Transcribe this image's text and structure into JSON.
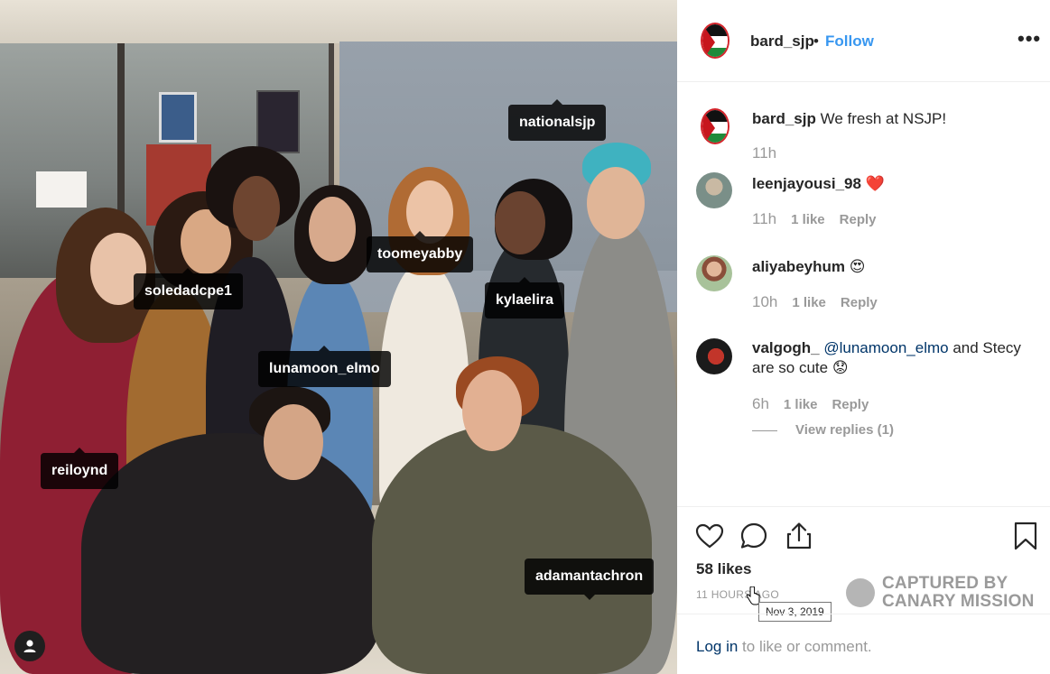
{
  "photo": {
    "tags": [
      "nationalsjp",
      "toomeyabby",
      "soledadcpe1",
      "kylaelira",
      "lunamoon_elmo",
      "reiloynd",
      "adamantachron"
    ],
    "colors": {
      "tag_bg": "#000000",
      "map_warm": "#f39b1d",
      "map_cool": "#35a7ff"
    }
  },
  "header": {
    "username": "bard_sjp",
    "separator": "•",
    "follow_label": "Follow",
    "more_icon": "more-horizontal-icon"
  },
  "comments": [
    {
      "user": "bard_sjp",
      "text": " We fresh at NSJP!",
      "time": "11h"
    },
    {
      "user": "leenjayousi_98",
      "text": "❤️",
      "time": "11h",
      "likes": "1 like",
      "reply": "Reply"
    },
    {
      "user": "aliyabeyhum",
      "text": "😍",
      "time": "10h",
      "likes": "1 like",
      "reply": "Reply"
    },
    {
      "user": "valgogh_",
      "mention": "@lunamoon_elmo",
      "text": " and Stecy are so cute 😟",
      "time": "6h",
      "likes": "1 like",
      "reply": "Reply"
    }
  ],
  "view_replies": "View replies (1)",
  "actions": {
    "likes": "58 likes",
    "time_ago": "11 HOURS AGO",
    "tooltip": "Nov 3, 2019",
    "login_link": "Log in",
    "login_rest": " to like or comment.",
    "icons": [
      "heart-icon",
      "comment-icon",
      "share-icon",
      "bookmark-icon"
    ]
  },
  "watermark": {
    "line1": "CAPTURED BY",
    "line2": "CANARY MISSION"
  },
  "accent_color": "#3897f0"
}
